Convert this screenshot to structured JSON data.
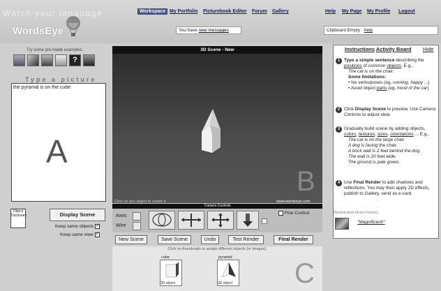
{
  "header": {
    "tagline": "Watch your language",
    "logo": "WordsEye",
    "logo_mark": "®",
    "nav": {
      "workspace": "Workspace",
      "portfolio": "My Portfolio",
      "picturebook_editor": "Picturebook Editor",
      "forum": "Forum",
      "gallery": "Gallery",
      "help": "Help",
      "my_page": "My Page",
      "my_profile": "My Profile",
      "logout": "Logout"
    },
    "messages_prefix": "You have",
    "messages_link": "new messages",
    "clipboard_status": "Clipboard Empty",
    "clipboard_help": "help"
  },
  "left": {
    "premade_label": "Try some pre-made examples.",
    "type_label": "Type a picture",
    "input_text": "the pyramid is on the cube",
    "big_letter": "A",
    "dictionary_label": "Object Dictionary",
    "display_button": "Display Scene",
    "keep_objects": "Keep same objects",
    "keep_view": "Keep same view"
  },
  "scene": {
    "title": "3D Scene  -  New",
    "hint": "Click on any object to center it",
    "url": "www.wordseye.com",
    "big_letter": "B",
    "controls_title": "Camera Controls",
    "axes": "Axes",
    "wire": "Wire",
    "fine_control": "Fine Control"
  },
  "actions": {
    "new_scene": "New Scene",
    "save_scene": "Save Scene",
    "undo": "Undo",
    "test_render": "Test Render",
    "final_render": "Final Render"
  },
  "objects": {
    "hint": "Click on thumbnails to assign different objects (or images).",
    "items": [
      {
        "name": "cube",
        "type": "3D object"
      },
      {
        "name": "pyramid",
        "type": "3D object"
      }
    ],
    "big_letter": "C"
  },
  "instructions": {
    "tab_instructions": "Instructions",
    "tab_activity": "Activity Board",
    "tab_hide": "Hide",
    "s1_a": "Type a simple sentence",
    "s1_b": " describing the ",
    "s1_c": "positions",
    "s1_d": " of common ",
    "s1_e": "objects",
    "s1_f": ". E.g.,",
    "s1_example": "The cat is on the chair.",
    "limits_title": "Some limitations:",
    "limit1_a": "No verbs/poses (eg, ",
    "limit1_b": "running, happy",
    "limit1_c": " ...)",
    "limit2_a": "Avoid object ",
    "limit2_b": "parts",
    "limit2_c": " (eg, ",
    "limit2_d": "hood of the car",
    "limit2_e": ")",
    "s2_a": "Click ",
    "s2_b": "Display Scene",
    "s2_c": " to preview. Use Camera Controls to adjust view.",
    "s3_a": "Gradually build scene by adding objects, ",
    "s3_b": "colors",
    "s3_c": ", ",
    "s3_d": "textures",
    "s3_e": ", ",
    "s3_f": "sizes",
    "s3_g": ", ",
    "s3_h": "orientations",
    "s3_i": " ... E.g.,",
    "ex1": "The cat is on the large chair.",
    "ex2": "A dog is facing the chair.",
    "ex3": "A brick wall is 2 feet behind the dog.",
    "ex4": "The wall is 20 feet wide.",
    "ex5": "The ground is pale green.",
    "s4_a": "Use ",
    "s4_b": "Final Render",
    "s4_c": " to add shadows and reflections. You may then apply 2D effects, publish to Gallery, send as e-card.",
    "recent_label": "Recent post (from Forum)",
    "recent_title": "\"Magnificent!\""
  }
}
